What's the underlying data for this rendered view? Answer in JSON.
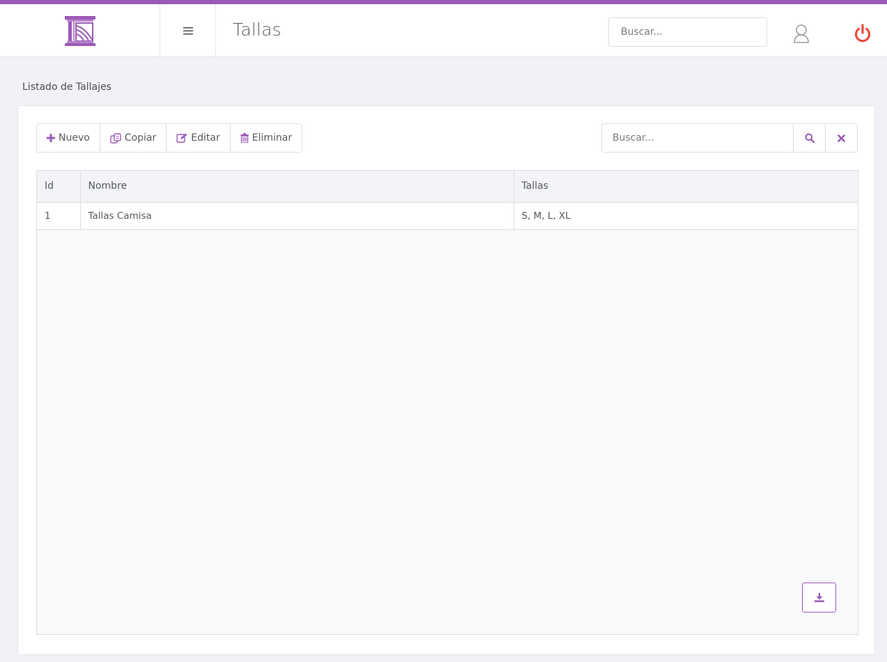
{
  "header": {
    "title": "Tallas",
    "search_placeholder": "Buscar...",
    "logo_icon": "building-logo-icon",
    "menu_icon": "hamburger-menu-icon",
    "user_icon": "user-icon",
    "power_icon": "power-icon"
  },
  "section": {
    "title": "Listado de Tallajes"
  },
  "toolbar": {
    "buttons": [
      {
        "label": "Nuevo",
        "icon": "plus-icon"
      },
      {
        "label": "Copiar",
        "icon": "copy-icon"
      },
      {
        "label": "Editar",
        "icon": "edit-icon"
      },
      {
        "label": "Eliminar",
        "icon": "trash-icon"
      }
    ],
    "search_placeholder": "Buscar...",
    "search_icon": "search-icon",
    "clear_icon": "close-icon"
  },
  "table": {
    "columns": [
      "Id",
      "Nombre",
      "Tallas"
    ],
    "rows": [
      [
        "1",
        "Tallas Camisa",
        "S, M, L, XL"
      ]
    ]
  },
  "footer": {
    "download_icon": "download-icon"
  },
  "colors": {
    "accent": "#9b59b6",
    "power": "#e74c3c",
    "background": "#f1f2f7"
  }
}
